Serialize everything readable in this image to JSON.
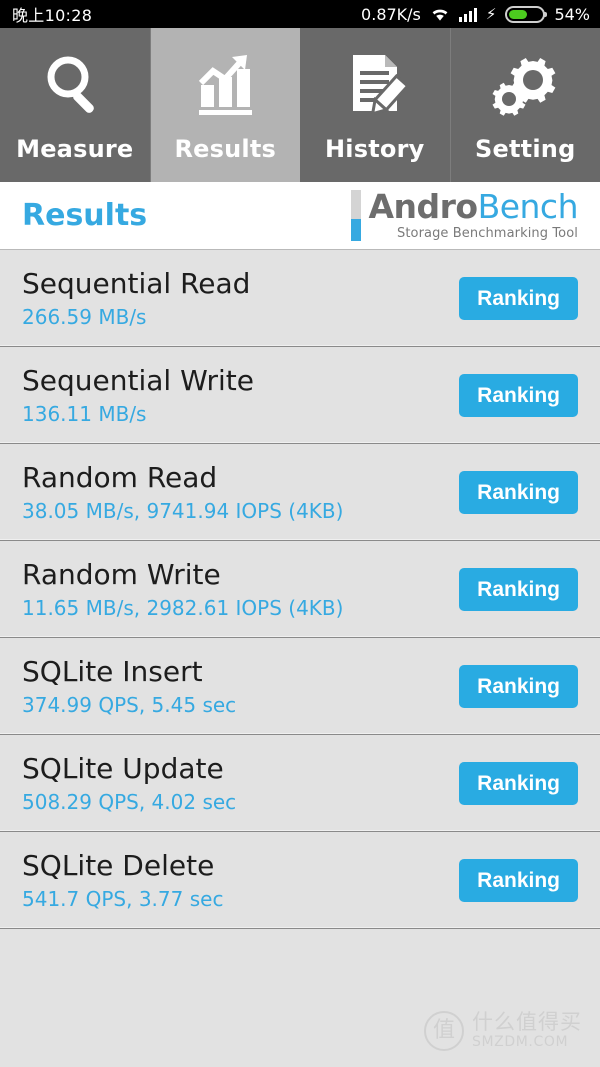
{
  "statusbar": {
    "time": "晚上10:28",
    "network_speed": "0.87K/s",
    "wifi_icon": "wifi-icon",
    "signal_icon": "cellular-signal-icon",
    "charging_icon": "lightning-bolt-icon",
    "battery_percent_label": "54%",
    "battery_level": 54
  },
  "tabs": [
    {
      "label": "Measure",
      "icon": "magnifier-icon",
      "active": false
    },
    {
      "label": "Results",
      "icon": "bar-chart-icon",
      "active": true
    },
    {
      "label": "History",
      "icon": "document-pencil-icon",
      "active": false
    },
    {
      "label": "Setting",
      "icon": "gears-icon",
      "active": false
    }
  ],
  "header": {
    "title": "Results",
    "logo_andro": "Andro",
    "logo_bench": "Bench",
    "logo_tagline": "Storage Benchmarking Tool"
  },
  "results": [
    {
      "title": "Sequential Read",
      "value": "266.59 MB/s",
      "button": "Ranking"
    },
    {
      "title": "Sequential Write",
      "value": "136.11 MB/s",
      "button": "Ranking"
    },
    {
      "title": "Random Read",
      "value": "38.05 MB/s, 9741.94 IOPS (4KB)",
      "button": "Ranking"
    },
    {
      "title": "Random Write",
      "value": "11.65 MB/s, 2982.61 IOPS (4KB)",
      "button": "Ranking"
    },
    {
      "title": "SQLite Insert",
      "value": "374.99 QPS, 5.45 sec",
      "button": "Ranking"
    },
    {
      "title": "SQLite Update",
      "value": "508.29 QPS, 4.02 sec",
      "button": "Ranking"
    },
    {
      "title": "SQLite Delete",
      "value": "541.7 QPS, 3.77 sec",
      "button": "Ranking"
    }
  ],
  "watermark": {
    "logo_char": "值",
    "cn_text": "什么值得买",
    "en_text": "SMZDM.COM"
  },
  "colors": {
    "accent_blue": "#36a9e1",
    "button_blue": "#29abe2",
    "tab_inactive": "#696969",
    "tab_active": "#b3b3b3",
    "list_bg": "#e2e2e2",
    "battery_green": "#4ccb1f"
  }
}
